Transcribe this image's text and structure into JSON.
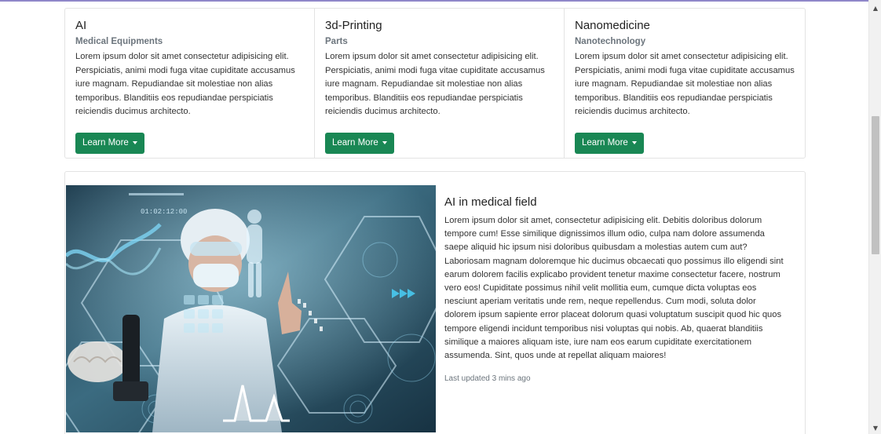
{
  "cards": [
    {
      "title": "AI",
      "subtitle": "Medical Equipments",
      "text": "Lorem ipsum dolor sit amet consectetur adipisicing elit. Perspiciatis, animi modi fuga vitae cupiditate accusamus iure magnam. Repudiandae sit molestiae non alias temporibus. Blanditiis eos repudiandae perspiciatis reiciendis ducimus architecto.",
      "button": "Learn More"
    },
    {
      "title": "3d-Printing",
      "subtitle": "Parts",
      "text": "Lorem ipsum dolor sit amet consectetur adipisicing elit. Perspiciatis, animi modi fuga vitae cupiditate accusamus iure magnam. Repudiandae sit molestiae non alias temporibus. Blanditiis eos repudiandae perspiciatis reiciendis ducimus architecto.",
      "button": "Learn More"
    },
    {
      "title": "Nanomedicine",
      "subtitle": "Nanotechnology",
      "text": "Lorem ipsum dolor sit amet consectetur adipisicing elit. Perspiciatis, animi modi fuga vitae cupiditate accusamus iure magnam. Repudiandae sit molestiae non alias temporibus. Blanditiis eos repudiandae perspiciatis reiciendis ducimus architecto.",
      "button": "Learn More"
    }
  ],
  "feature": {
    "title": "AI in medical field",
    "text": "Lorem ipsum dolor sit amet, consectetur adipisicing elit. Debitis doloribus dolorum tempore cum! Esse similique dignissimos illum odio, culpa nam dolore assumenda saepe aliquid hic ipsum nisi doloribus quibusdam a molestias autem cum aut? Laboriosam magnam doloremque hic ducimus obcaecati quo possimus illo eligendi sint earum dolorem facilis explicabo provident tenetur maxime consectetur facere, nostrum vero eos! Cupiditate possimus nihil velit mollitia eum, cumque dicta voluptas eos nesciunt aperiam veritatis unde rem, neque repellendus. Cum modi, soluta dolor dolorem ipsum sapiente error placeat dolorum quasi voluptatum suscipit quod hic quos tempore eligendi incidunt temporibus nisi voluptas qui nobis. Ab, quaerat blanditiis similique a maiores aliquam iste, iure nam eos earum cupiditate exercitationem assumenda. Sint, quos unde at repellat aliquam maiores!",
    "updated": "Last updated 3 mins ago",
    "image": {
      "hud_time": "01:02:12:00",
      "description_icon": "medical-ai-hud-image"
    }
  },
  "colors": {
    "button_bg": "#198754",
    "subtitle": "#6c757d",
    "top_rule": "#8f87c9"
  }
}
